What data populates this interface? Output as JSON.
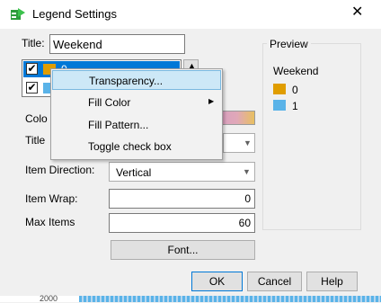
{
  "window": {
    "title": "Legend Settings",
    "close_glyph": "✕"
  },
  "title_field": {
    "label": "Title:",
    "value": "Weekend"
  },
  "legend_list": {
    "items": [
      {
        "label": "0",
        "color": "#e09d00",
        "checked": true
      },
      {
        "label": "1",
        "color": "#5ab3e8",
        "checked": true
      }
    ]
  },
  "color_row": {
    "label": "Colo"
  },
  "title_row": {
    "label": "Title"
  },
  "item_direction": {
    "label": "Item Direction:",
    "value": "Vertical"
  },
  "item_wrap": {
    "label": "Item Wrap:",
    "value": "0"
  },
  "max_items": {
    "label": "Max Items",
    "value": "60"
  },
  "font_button": {
    "label": "Font..."
  },
  "preview": {
    "label": "Preview",
    "title": "Weekend",
    "items": [
      {
        "label": "0",
        "color": "#e09d00"
      },
      {
        "label": "1",
        "color": "#5ab3e8"
      }
    ]
  },
  "buttons": {
    "ok": "OK",
    "cancel": "Cancel",
    "help": "Help"
  },
  "context_menu": {
    "items": [
      {
        "label": "Transparency..."
      },
      {
        "label": "Fill Color"
      },
      {
        "label": "Fill Pattern..."
      },
      {
        "label": "Toggle check box"
      }
    ]
  },
  "background_text": "2000"
}
